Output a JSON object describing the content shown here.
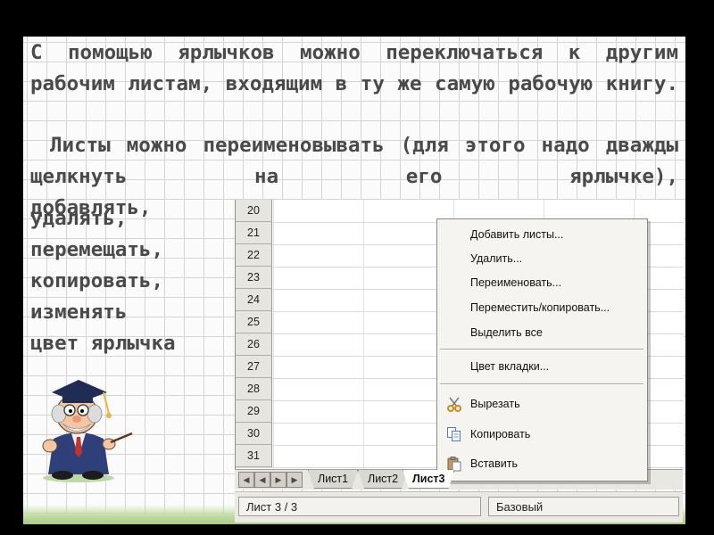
{
  "slide": {
    "paragraph1": "С помощью ярлычков можно переключаться к другим рабочим листам, входящим в ту же самую рабочую книгу.",
    "paragraph2": "Листы можно переименовывать (для этого надо дважды щелкнуть на его ярлычке),",
    "word_add": "добавлять,",
    "actions": [
      "удалять,",
      "перемещать,",
      "копировать,",
      "изменять",
      "цвет ярлычка"
    ]
  },
  "spreadsheet": {
    "row_numbers": [
      "20",
      "21",
      "22",
      "23",
      "24",
      "25",
      "26",
      "27",
      "28",
      "29",
      "30",
      "31"
    ],
    "tabs": [
      "Лист1",
      "Лист2",
      "Лист3"
    ],
    "active_tab": "Лист3",
    "status_sheet": "Лист 3 / 3",
    "status_style": "Базовый"
  },
  "context_menu": {
    "add_sheets": "Добавить листы...",
    "delete": "Удалить...",
    "rename": "Переименовать...",
    "move_copy": "Переместить/копировать...",
    "select_all": "Выделить все",
    "tab_color": "Цвет вкладки...",
    "cut": "Вырезать",
    "copy": "Копировать",
    "paste": "Вставить"
  },
  "icons": {
    "cut": "scissors-icon",
    "copy": "copy-icon",
    "paste": "paste-icon",
    "mascot": "professor-mascot"
  },
  "colors": {
    "text": "#4a4a4a",
    "grid": "#d4d4d4",
    "menu_bg": "#f5f4f1"
  }
}
